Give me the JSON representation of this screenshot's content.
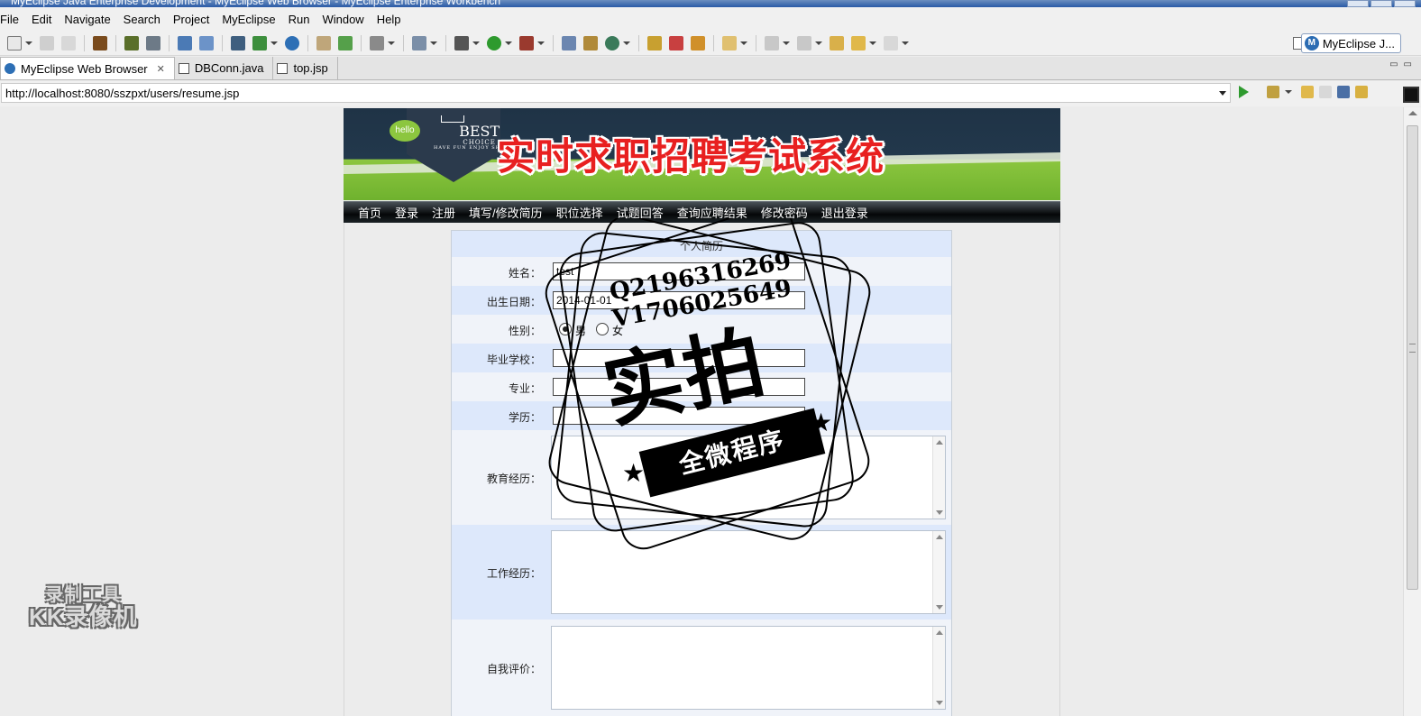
{
  "window": {
    "title": "MyEclipse Java Enterprise Development - MyEclipse Web Browser - MyEclipse Enterprise Workbench"
  },
  "menu": [
    "File",
    "Edit",
    "Navigate",
    "Search",
    "Project",
    "MyEclipse",
    "Run",
    "Window",
    "Help"
  ],
  "perspective": {
    "label": "MyEclipse J..."
  },
  "tabs": [
    {
      "label": "MyEclipse Web Browser",
      "active": true,
      "icon": "globe-icon"
    },
    {
      "label": "DBConn.java",
      "active": false,
      "icon": "java-file-icon"
    },
    {
      "label": "top.jsp",
      "active": false,
      "icon": "jsp-file-icon"
    }
  ],
  "browser": {
    "url": "http://localhost:8080/sszpxt/users/resume.jsp"
  },
  "site": {
    "banner_title": "实时求职招聘考试系统",
    "logo_hello": "hello",
    "logo_best": "BEST",
    "logo_choice": "CHOICE",
    "logo_small": "HAVE FUN ENJOY SHOPPING",
    "nav": [
      "首页",
      "登录",
      "注册",
      "填写/修改简历",
      "职位选择",
      "试题回答",
      "查询应聘结果",
      "修改密码",
      "退出登录"
    ]
  },
  "form": {
    "caption": "个人简历",
    "name_label": "姓名：",
    "name_value": "test",
    "birth_label": "出生日期：",
    "birth_value": "2014-01-01",
    "gender_label": "性别：",
    "gender_options": [
      "男",
      "女"
    ],
    "gender_selected": "男",
    "school_label": "毕业学校：",
    "major_label": "专业：",
    "degree_label": "学历：",
    "education_label": "教育经历：",
    "work_label": "工作经历：",
    "self_label": "自我评价："
  },
  "watermark": {
    "line1": "Q2196316269",
    "line2": "V1706025649",
    "big": "实拍",
    "ribbon": "全微程序",
    "recorder_line1": "录制工具",
    "recorder_line2": "KK录像机"
  },
  "colors": {
    "title_red": "#e82020",
    "banner_green": "#8cc63f",
    "row_blue": "#dde8fb"
  }
}
